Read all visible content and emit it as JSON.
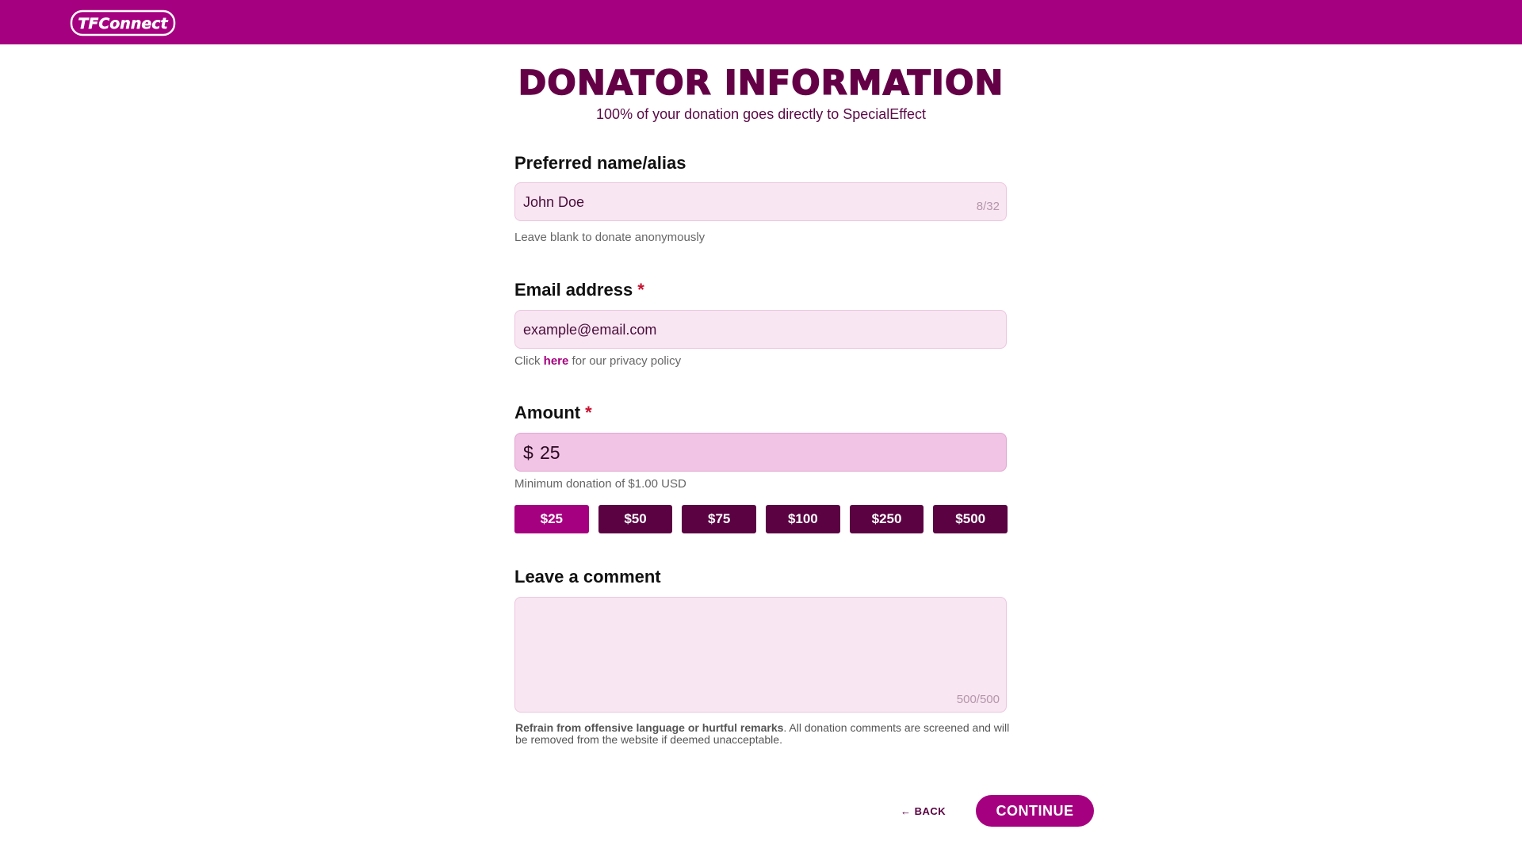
{
  "header": {
    "logo_text": "TFConnect",
    "brand_color": "#a5007f"
  },
  "page": {
    "title": "DONATOR INFORMATION",
    "subtitle": "100% of your donation goes directly to SpecialEffect"
  },
  "name_field": {
    "label": "Preferred name/alias",
    "value": "John Doe",
    "counter": "8/32",
    "hint": "Leave blank to donate anonymously"
  },
  "email_field": {
    "label": "Email address",
    "required_mark": "*",
    "value": "example@email.com",
    "hint_prefix": "Click",
    "hint_link": "here",
    "hint_suffix": "for our privacy policy"
  },
  "amount_field": {
    "label": "Amount",
    "required_mark": "*",
    "currency_symbol": "$",
    "value": "25",
    "hint": "Minimum donation of $1.00 USD",
    "presets": [
      "$25",
      "$50",
      "$75",
      "$100",
      "$250",
      "$500"
    ],
    "selected_preset": "$25"
  },
  "comment_field": {
    "label": "Leave a comment",
    "value": "",
    "counter": "500/500",
    "disclaimer_bold": "Refrain from offensive language or hurtful remarks",
    "disclaimer_rest": ". All donation comments are screened and will be removed from the website if deemed unacceptable."
  },
  "actions": {
    "back_label": "← BACK",
    "continue_label": "CONTINUE"
  }
}
